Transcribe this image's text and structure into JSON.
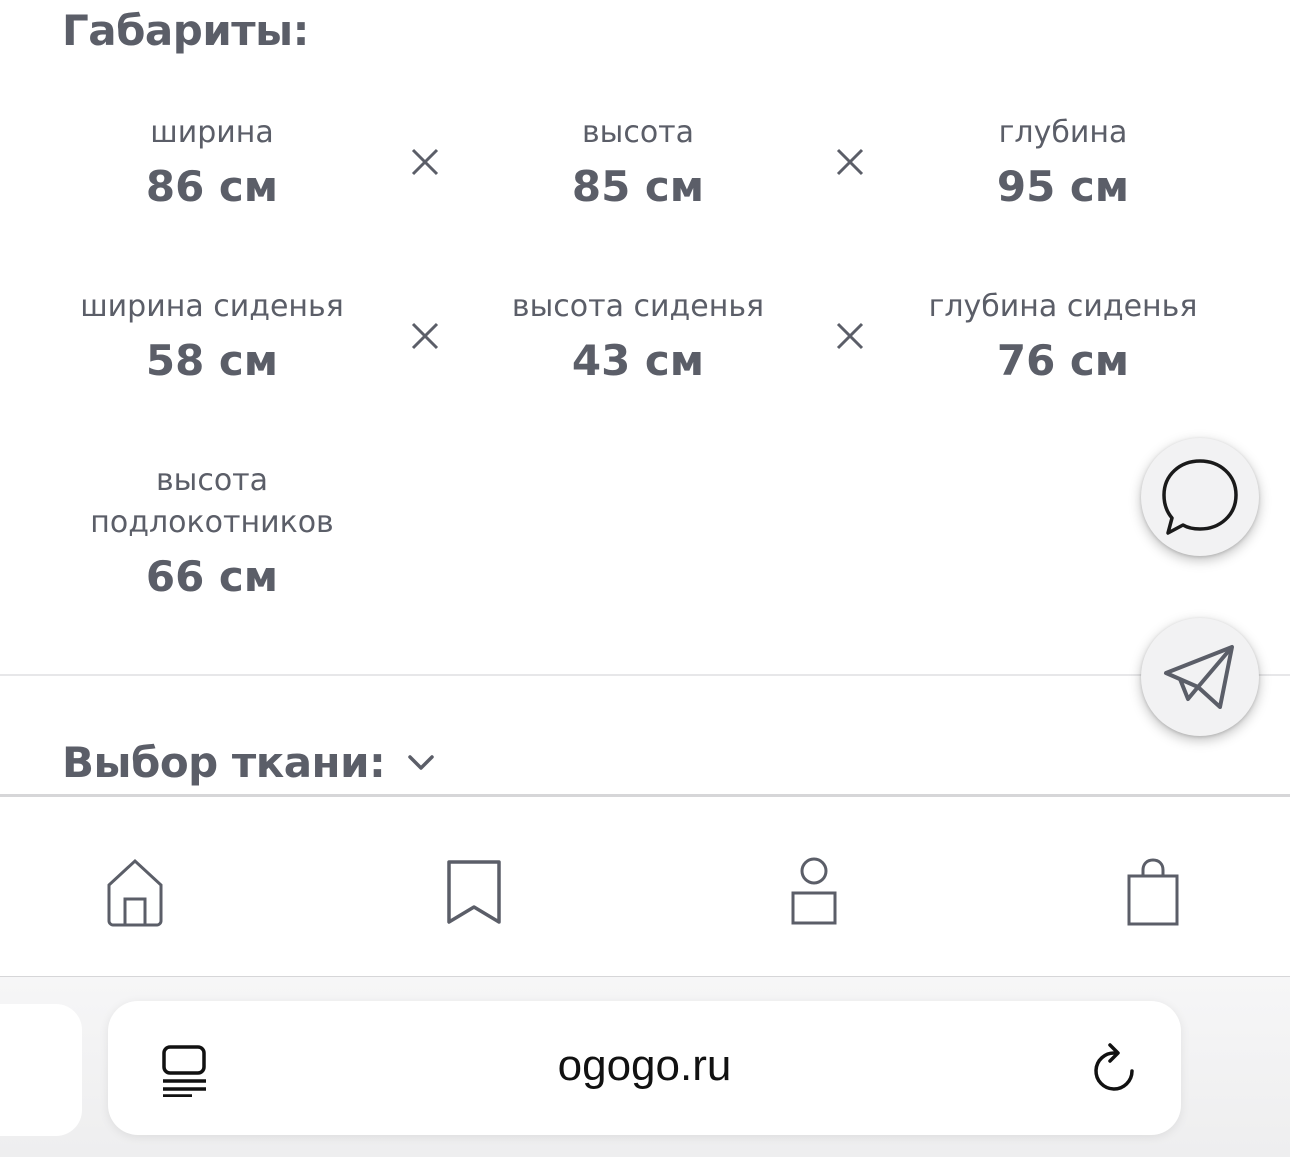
{
  "dimensions": {
    "title": "Габариты:",
    "items": [
      {
        "label": "ширина",
        "value": "86 см"
      },
      {
        "label": "высота",
        "value": "85 см"
      },
      {
        "label": "глубина",
        "value": "95 см"
      },
      {
        "label": "ширина сиденья",
        "value": "58 см"
      },
      {
        "label": "высота сиденья",
        "value": "43 см"
      },
      {
        "label": "глубина сиденья",
        "value": "76 см"
      },
      {
        "label_line1": "высота",
        "label_line2": "подлокотников",
        "value": "66 см"
      }
    ]
  },
  "fabric": {
    "title": "Выбор ткани:"
  },
  "floating_buttons": {
    "chat_icon": "chat-bubble-icon",
    "telegram_icon": "paper-plane-icon"
  },
  "tabbar": {
    "icons": [
      "home-icon",
      "bookmark-icon",
      "profile-icon",
      "shopping-bag-icon"
    ]
  },
  "browser": {
    "url": "ogogo.ru"
  },
  "colors": {
    "text": "#5b5e68",
    "divider": "#e7e7e9",
    "url_text": "#111111"
  }
}
